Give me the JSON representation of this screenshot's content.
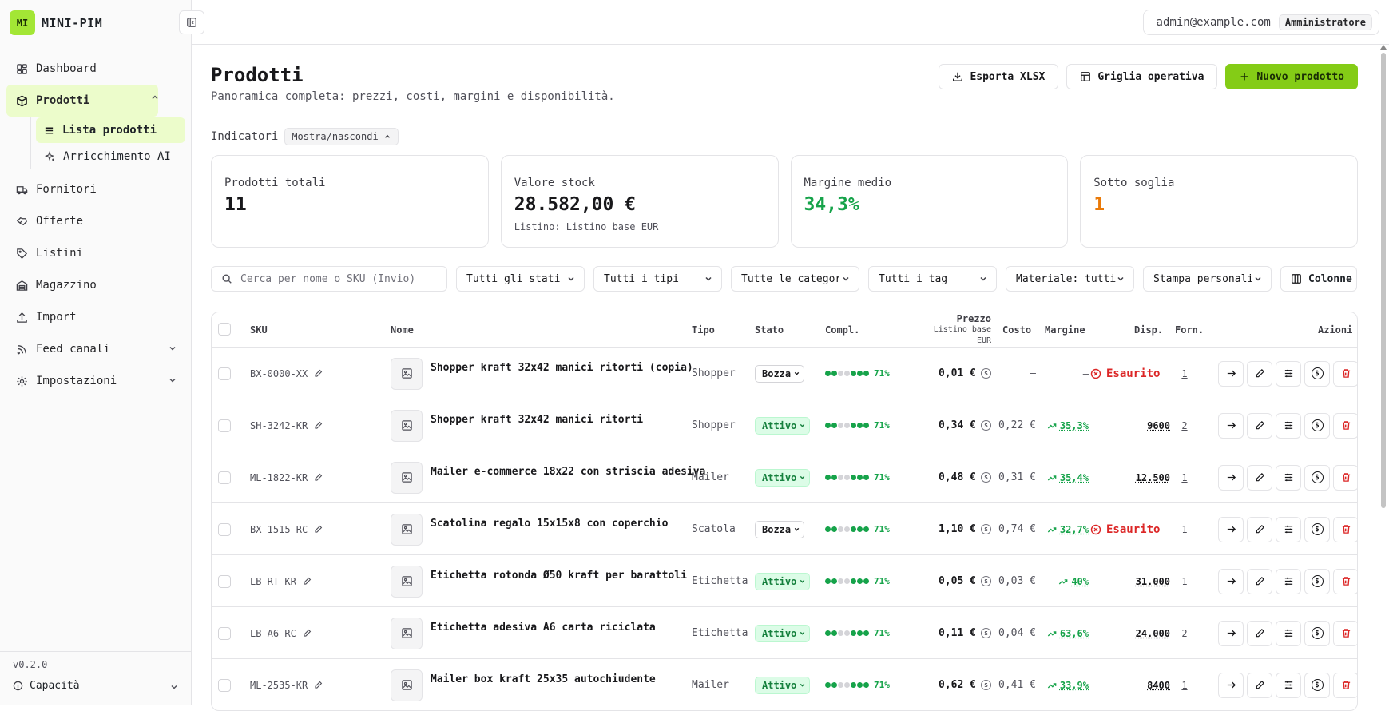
{
  "brand": {
    "initials": "MI",
    "name": "MINI-PIM"
  },
  "sidebar": {
    "items": [
      {
        "label": "Dashboard",
        "icon": "dashboard-icon"
      },
      {
        "label": "Prodotti",
        "icon": "package-icon"
      },
      {
        "label": "Fornitori",
        "icon": "truck-icon"
      },
      {
        "label": "Offerte",
        "icon": "offer-icon"
      },
      {
        "label": "Listini",
        "icon": "tag-icon"
      },
      {
        "label": "Magazzino",
        "icon": "warehouse-icon"
      },
      {
        "label": "Import",
        "icon": "upload-icon"
      },
      {
        "label": "Feed canali",
        "icon": "rss-icon"
      },
      {
        "label": "Impostazioni",
        "icon": "gear-icon"
      }
    ],
    "sub_items": [
      {
        "label": "Lista prodotti",
        "icon": "list-icon"
      },
      {
        "label": "Arricchimento AI",
        "icon": "sparkles-icon"
      }
    ],
    "version": "v0.2.0",
    "capacity_label": "Capacità"
  },
  "topbar": {
    "user_email": "admin@example.com",
    "user_role": "Amministratore"
  },
  "page": {
    "title": "Prodotti",
    "subtitle": "Panoramica completa: prezzi, costi, margini e disponibilità.",
    "export_label": "Esporta XLSX",
    "grid_label": "Griglia operativa",
    "new_label": "Nuovo prodotto"
  },
  "indicators": {
    "label": "Indicatori",
    "toggle_label": "Mostra/nascondi"
  },
  "kpis": [
    {
      "label": "Prodotti totali",
      "value": "11",
      "note": "",
      "color": "#18181b"
    },
    {
      "label": "Valore stock",
      "value": "28.582,00 €",
      "note": "Listino: Listino base EUR",
      "color": "#18181b"
    },
    {
      "label": "Margine medio",
      "value": "34,3%",
      "note": "",
      "color": "#16a34a"
    },
    {
      "label": "Sotto soglia",
      "value": "1",
      "note": "",
      "color": "#ea7a09"
    }
  ],
  "filters": {
    "search_placeholder": "Cerca per nome o SKU (Invio)",
    "status": "Tutti gli stati",
    "type": "Tutti i tipi",
    "category": "Tutte le categorie",
    "tag": "Tutti i tag",
    "material": "Materiale: tutti",
    "print": "Stampa personalizzata",
    "columns_label": "Colonne"
  },
  "table": {
    "headers": {
      "sku": "SKU",
      "name": "Nome",
      "type": "Tipo",
      "status": "Stato",
      "compl": "Compl.",
      "price_line1": "Prezzo",
      "price_line2": "Listino base",
      "price_line3": "EUR",
      "cost": "Costo",
      "margin": "Margine",
      "disp": "Disp.",
      "forn": "Forn.",
      "actions": "Azioni"
    },
    "rows": [
      {
        "sku": "BX-0000-XX",
        "name": "Shopper kraft 32x42 manici ritorti (copia)",
        "type": "Shopper",
        "status": "Bozza",
        "status_kind": "draft",
        "completeness": 0.71,
        "compl": "71%",
        "price": "0,01 €",
        "cost": "–",
        "margin": "–",
        "margin_kind": "none",
        "disp": "Esaurito",
        "disp_kind": "out",
        "forn": "1"
      },
      {
        "sku": "SH-3242-KR",
        "name": "Shopper kraft 32x42 manici ritorti",
        "type": "Shopper",
        "status": "Attivo",
        "status_kind": "active",
        "completeness": 0.71,
        "compl": "71%",
        "price": "0,34 €",
        "cost": "0,22 €",
        "margin": "35,3%",
        "margin_kind": "up",
        "disp": "9600",
        "disp_kind": "num",
        "forn": "2"
      },
      {
        "sku": "ML-1822-KR",
        "name": "Mailer e-commerce 18x22 con striscia adesiva",
        "type": "Mailer",
        "status": "Attivo",
        "status_kind": "active",
        "completeness": 0.71,
        "compl": "71%",
        "price": "0,48 €",
        "cost": "0,31 €",
        "margin": "35,4%",
        "margin_kind": "up",
        "disp": "12.500",
        "disp_kind": "num",
        "forn": "1"
      },
      {
        "sku": "BX-1515-RC",
        "name": "Scatolina regalo 15x15x8 con coperchio",
        "type": "Scatola",
        "status": "Bozza",
        "status_kind": "draft",
        "completeness": 0.71,
        "compl": "71%",
        "price": "1,10 €",
        "cost": "0,74 €",
        "margin": "32,7%",
        "margin_kind": "up",
        "disp": "Esaurito",
        "disp_kind": "out",
        "forn": "1"
      },
      {
        "sku": "LB-RT-KR",
        "name": "Etichetta rotonda Ø50 kraft per barattoli",
        "type": "Etichetta",
        "status": "Attivo",
        "status_kind": "active",
        "completeness": 0.71,
        "compl": "71%",
        "price": "0,05 €",
        "cost": "0,03 €",
        "margin": "40%",
        "margin_kind": "up",
        "disp": "31.000",
        "disp_kind": "num",
        "forn": "1"
      },
      {
        "sku": "LB-A6-RC",
        "name": "Etichetta adesiva A6 carta riciclata",
        "type": "Etichetta",
        "status": "Attivo",
        "status_kind": "active",
        "completeness": 0.71,
        "compl": "71%",
        "price": "0,11 €",
        "cost": "0,04 €",
        "margin": "63,6%",
        "margin_kind": "up",
        "disp": "24.000",
        "disp_kind": "num",
        "forn": "2"
      },
      {
        "sku": "ML-2535-KR",
        "name": "Mailer box kraft 25x35 autochiudente",
        "type": "Mailer",
        "status": "Attivo",
        "status_kind": "active",
        "completeness": 0.71,
        "compl": "71%",
        "price": "0,62 €",
        "cost": "0,41 €",
        "margin": "33,9%",
        "margin_kind": "up",
        "disp": "8400",
        "disp_kind": "num",
        "forn": "1"
      }
    ]
  },
  "colors": {
    "accent": "#84cc16",
    "accent_light": "#ecfccb",
    "success": "#16a34a",
    "danger": "#dc2626",
    "warning": "#ea7a09"
  }
}
